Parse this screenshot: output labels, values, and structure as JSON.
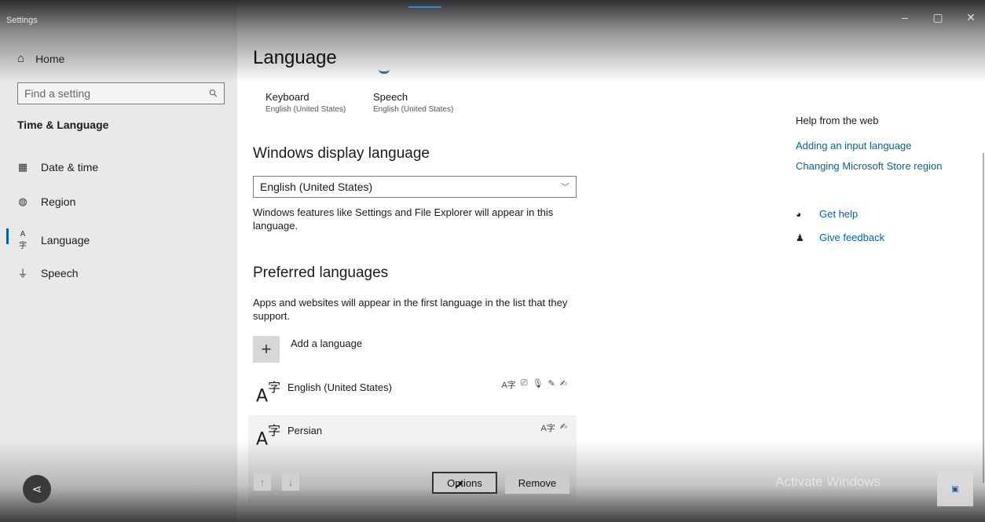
{
  "window": {
    "app_title": "Settings",
    "controls": [
      "–",
      "▢",
      "✕"
    ]
  },
  "sidebar": {
    "home_label": "Home",
    "search_placeholder": "Find a setting",
    "section_title": "Time & Language",
    "items": [
      {
        "label": "Date & time",
        "icon": "calendar-clock-icon"
      },
      {
        "label": "Region",
        "icon": "globe-icon"
      },
      {
        "label": "Language",
        "icon": "language-icon",
        "active": true
      },
      {
        "label": "Speech",
        "icon": "microphone-icon"
      }
    ]
  },
  "main": {
    "title": "Language",
    "tiles": [
      {
        "label": "Keyboard",
        "sub": "English (United States)"
      },
      {
        "label": "Speech",
        "sub": "English (United States)"
      }
    ],
    "display_language": {
      "heading": "Windows display language",
      "selected": "English (United States)",
      "description": "Windows features like Settings and File Explorer will appear in this language."
    },
    "preferred": {
      "heading": "Preferred languages",
      "description": "Apps and websites will appear in the first language in the list that they support.",
      "add_label": "Add a language",
      "languages": [
        {
          "name": "English (United States)",
          "features": [
            "A字",
            "⎚",
            "🎙",
            "✎",
            "✍"
          ]
        },
        {
          "name": "Persian",
          "features": [
            "A字",
            "✍"
          ]
        }
      ],
      "options_label": "Options",
      "remove_label": "Remove",
      "up_icon": "↑",
      "down_icon": "↓"
    }
  },
  "help": {
    "title": "Help from the web",
    "links": [
      "Adding an input language",
      "Changing Microsoft Store region"
    ],
    "get_help": "Get help",
    "give_feedback": "Give feedback"
  },
  "watermark": "Activate Windows"
}
